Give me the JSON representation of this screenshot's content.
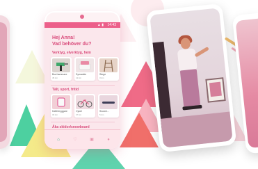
{
  "app": {
    "greeting_line1": "Hej Anna!",
    "greeting_line2": "Vad behöver du?",
    "statusbar_time": "14:43",
    "statusbar_icons": "▲ ▮"
  },
  "sections": [
    {
      "title": "Verktyg, elverktyg, hem",
      "cards": [
        {
          "label": "Borrhammare",
          "sub": "45 km"
        },
        {
          "label": "Symaskin",
          "sub": "12 km"
        },
        {
          "label": "Stege",
          "sub": "3 km"
        }
      ]
    },
    {
      "title": "Tält, sport, fritid",
      "cards": [
        {
          "label": "Kaffebryggare",
          "sub": "33 km"
        },
        {
          "label": "Cykel",
          "sub": "27 km"
        },
        {
          "label": "Snowb...",
          "sub": "5 km"
        }
      ]
    },
    {
      "title": "Åka skidor/snowboard",
      "cards": []
    }
  ],
  "fab": {
    "label": "+"
  },
  "tabbar": {
    "icons": [
      "home-icon",
      "search-icon",
      "chat-icon",
      "profile-icon"
    ],
    "glyphs": [
      "⌂",
      "♡",
      "▣",
      "●"
    ]
  },
  "colors": {
    "brand_pink": "#ec5f8a",
    "accent_green": "#2bb585",
    "card_bg": "#ffffff"
  }
}
